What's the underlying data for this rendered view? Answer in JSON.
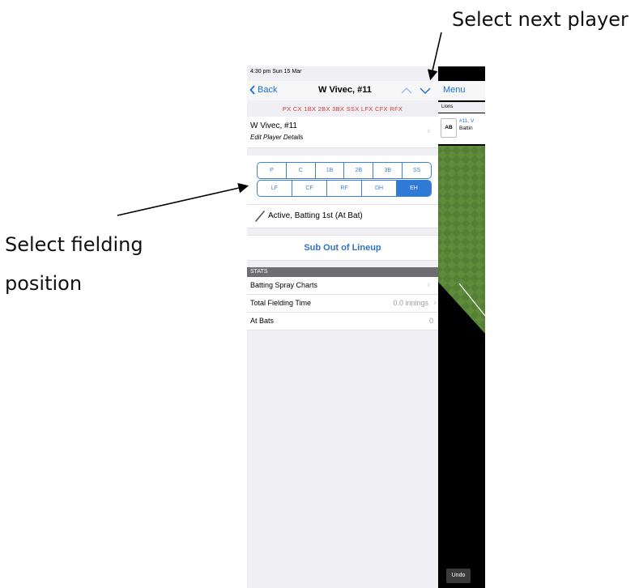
{
  "annotations": {
    "next_player": "Select next player",
    "fielding_line1": "Select fielding",
    "fielding_line2": "position"
  },
  "status_bar": {
    "time": "4:30 pm  Sun 15 Mar"
  },
  "nav": {
    "back_label": "Back",
    "title": "W Vivec, #11"
  },
  "error_strip": "PX  CX  1BX  2BX  3BX  SSX  LFX  CFX  RFX",
  "player": {
    "name": "W Vivec, #11",
    "subtitle": "Edit Player Details"
  },
  "positions": {
    "row1": [
      "P",
      "C",
      "1B",
      "2B",
      "3B",
      "SS"
    ],
    "row2": [
      "LF",
      "CF",
      "RF",
      "DH",
      "EH"
    ],
    "selected": "EH"
  },
  "status_line": "Active, Batting 1st (At Bat)",
  "sub_out_label": "Sub Out of Lineup",
  "stats": {
    "header": "STATS",
    "rows": [
      {
        "label": "Batting Spray Charts",
        "value": ""
      },
      {
        "label": "Total Fielding Time",
        "value": "0.0 innings"
      },
      {
        "label": "At Bats",
        "value": "0"
      }
    ]
  },
  "right_panel": {
    "menu_label": "Menu",
    "team": "Lions",
    "ab_label": "AB",
    "batter_num": "#11, V",
    "batter_status": "Battin",
    "undo_label": "Undo"
  },
  "colors": {
    "accent": "#2f7ad6",
    "error": "#d23c3c",
    "field_green": "#5d8a3a"
  }
}
